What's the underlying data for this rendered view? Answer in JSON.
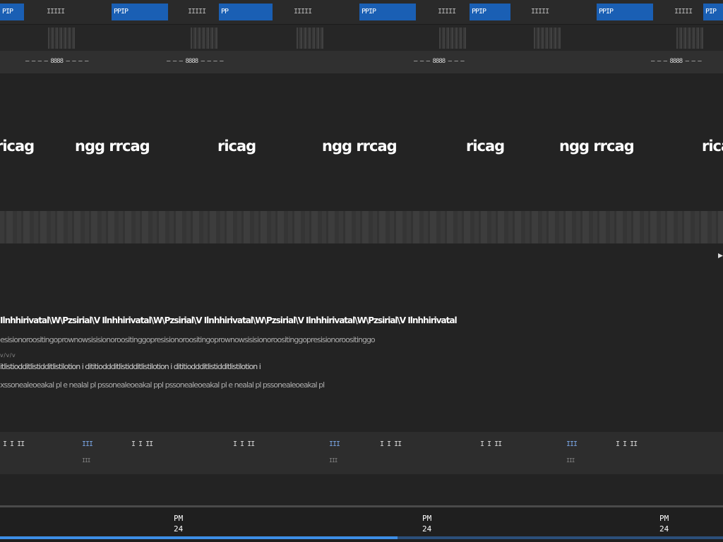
{
  "topbar": {
    "tab_fragments": [
      {
        "blue": "PIP",
        "grey": ""
      },
      {
        "blue": "",
        "grey": "IIIII"
      },
      {
        "blue": "PPIP",
        "grey": ""
      },
      {
        "blue": "",
        "grey": "IIIII"
      },
      {
        "blue": "PP",
        "grey": ""
      },
      {
        "blue": "",
        "grey": "IIIII"
      },
      {
        "blue": "PPIP",
        "grey": ""
      },
      {
        "blue": "",
        "grey": "IIIII"
      },
      {
        "blue": "PPIP",
        "grey": ""
      },
      {
        "blue": "",
        "grey": "IIIII"
      },
      {
        "blue": "PPIP",
        "grey": ""
      },
      {
        "blue": "",
        "grey": "IIIII"
      },
      {
        "blue": "PIP",
        "grey": ""
      }
    ]
  },
  "sub_labels": [
    "— — — — 8888 — — — —",
    "— — — 8888 — — — —",
    "— — — 8888 — — —",
    "— — — 8888 — — —"
  ],
  "headings": [
    "ricag",
    "ngg rrcag",
    "ricag",
    "ngg rrcag",
    "ricag",
    "ngg rrcag",
    "ricag"
  ],
  "text_lines": {
    "line1": "Ilnhhirivatal\\W\\Pzsirial\\V Ilnhhirivatal\\W\\Pzsirial\\V Ilnhhirivatal\\W\\Pzsirial\\V Ilnhhirivatal\\W\\Pzsirial\\V Ilnhhirivatal",
    "line2": "esisionoroositingoprownowsisisionoroositinggopresisionoroositingoprownowsisisionoroositinggopresisionoroositinggo",
    "line3": "v /                                                     v /                                                  v",
    "line4": "itlistiodditlistidditlistilotion  i  dititioddditlistidditlistilotion  i  dititioddditlistidditlistilotion  i",
    "line5": "xssonealeoeakal pl  e  nealal pl pssonealeoeakal ppl pssonealeoeakal pl  e  nealal pl pssonealeoeakal pl"
  },
  "markers": [
    "I  I  II",
    "III",
    "I  I  II",
    "III",
    "I  I  II",
    "III",
    "I  I  II"
  ],
  "clock_times": [
    {
      "period": "PM",
      "day": "24"
    },
    {
      "period": "PM",
      "day": "24"
    },
    {
      "period": "PM",
      "day": "24"
    }
  ],
  "progress": 0.55,
  "colors": {
    "accent": "#1a5fb4",
    "background": "#232323"
  }
}
